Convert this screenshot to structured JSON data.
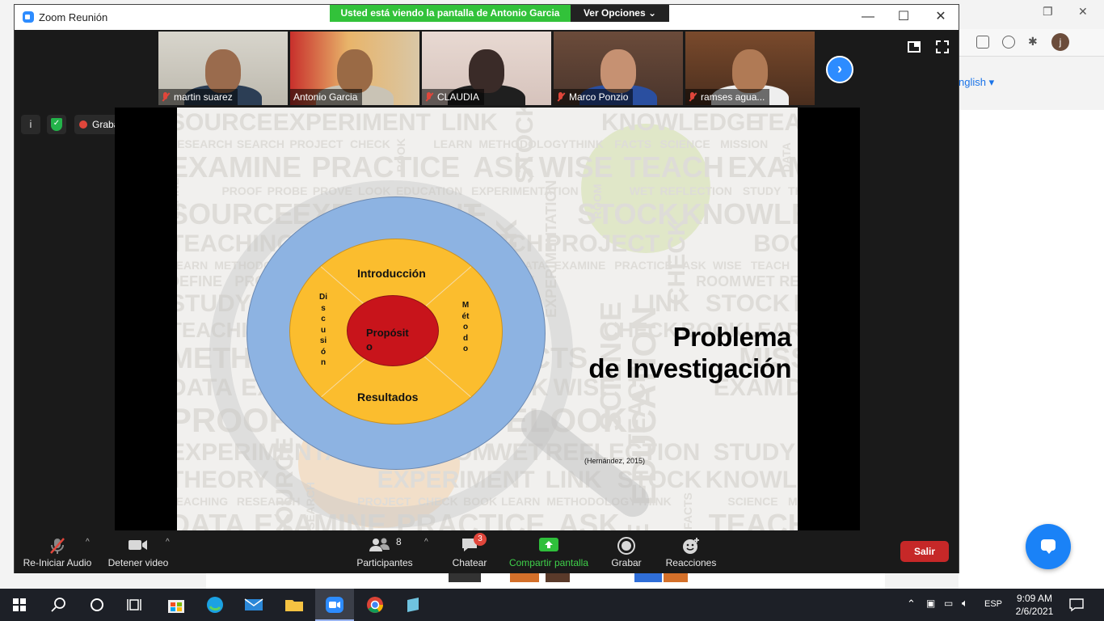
{
  "window": {
    "title": "Zoom Reunión",
    "minimize": "—",
    "maximize": "☐",
    "close": "✕"
  },
  "share_banner": {
    "text": "Usted está viendo la pantalla de Antonio Garcia",
    "options_label": "Ver Opciones ⌄"
  },
  "participants": [
    {
      "name": "martin suarez",
      "muted": true
    },
    {
      "name": "Antonio Garcia",
      "muted": false,
      "active": true
    },
    {
      "name": "CLAUDIA",
      "muted": true
    },
    {
      "name": "Marco Ponzio",
      "muted": true
    },
    {
      "name": "ramses agua...",
      "muted": true
    }
  ],
  "recording": {
    "label": "Grabando"
  },
  "slide": {
    "ring_top": "Introducción",
    "ring_bottom": "Resultados",
    "ring_left": "Discusión",
    "ring_right": "Método",
    "core_line1": "Propósit",
    "core_line2": "o",
    "title_line1": "Problema",
    "title_line2": "de Investigación",
    "citation": "(Hernández, 2015)",
    "background_words": [
      "SOURCE",
      "EXPERIMENT",
      "LINK",
      "STOCK",
      "KNOWLEDGE",
      "TEACHING",
      "RESEARCH",
      "SEARCH",
      "PROJECT",
      "CHECK",
      "BOOK",
      "LEARN",
      "METHODOLOGY",
      "THINK",
      "FACTS",
      "SCIENCE",
      "MISSION",
      "DATA",
      "EXAMINE",
      "PRACTICE",
      "ASK",
      "WISE",
      "TEACH",
      "EXAM",
      "DEFINE",
      "PROOF",
      "PROBE",
      "PROVE",
      "LOOK",
      "EDUCATION",
      "EXPERIMENTATION",
      "ROOM",
      "WET",
      "REFLECTION",
      "STUDY",
      "THEORY"
    ]
  },
  "controls": {
    "audio_label": "Re-Iniciar Audio",
    "video_label": "Detener video",
    "participants_label": "Participantes",
    "participants_count": "8",
    "chat_label": "Chatear",
    "chat_badge": "3",
    "share_label": "Compartir pantalla",
    "record_label": "Grabar",
    "reactions_label": "Reacciones",
    "exit_label": "Salir"
  },
  "background": {
    "lang_link": "nglish ▾",
    "avatar_letter": "j"
  },
  "taskbar": {
    "lang": "ESP",
    "time": "9:09 AM",
    "date": "2/6/2021"
  },
  "colors": {
    "zoom_blue": "#2d8cff",
    "share_green": "#32c23a",
    "exit_red": "#c62828",
    "ring_blue": "#8db3e2",
    "ring_orange": "#fbbd2e",
    "core_red": "#c8141b"
  }
}
